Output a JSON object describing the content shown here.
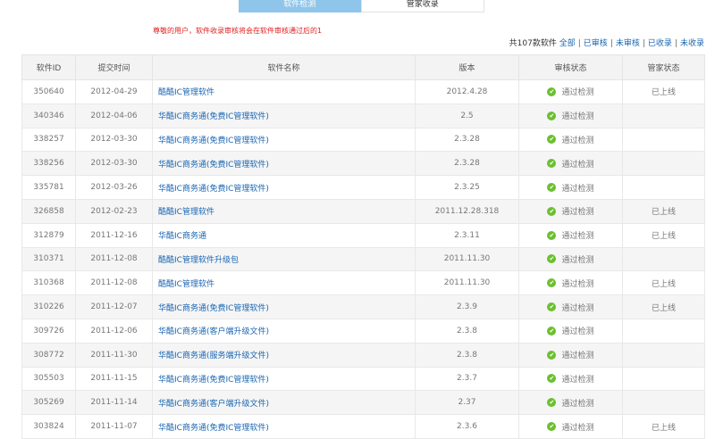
{
  "tabs": [
    {
      "label": "软件检测",
      "active": true
    },
    {
      "label": "管家收录",
      "active": false
    }
  ],
  "notice": "尊敬的用户，软件收录审核将会在软件审核通过后的1",
  "summary": {
    "count_text": "共107款软件",
    "filters": [
      "全部",
      "已审核",
      "未审核",
      "已收录",
      "未收录"
    ]
  },
  "table": {
    "headers": [
      "软件ID",
      "提交时间",
      "软件名称",
      "版本",
      "审核状态",
      "管家状态"
    ],
    "rows": [
      {
        "id": "350640",
        "date": "2012-04-29",
        "name": "酷酷IC管理软件",
        "version": "2012.4.28",
        "status": "通过检测",
        "manager": "已上线"
      },
      {
        "id": "340346",
        "date": "2012-04-06",
        "name": "华酷IC商务通(免费IC管理软件)",
        "version": "2.5",
        "status": "通过检测",
        "manager": ""
      },
      {
        "id": "338257",
        "date": "2012-03-30",
        "name": "华酷IC商务通(免费IC管理软件)",
        "version": "2.3.28",
        "status": "通过检测",
        "manager": ""
      },
      {
        "id": "338256",
        "date": "2012-03-30",
        "name": "华酷IC商务通(免费IC管理软件)",
        "version": "2.3.28",
        "status": "通过检测",
        "manager": ""
      },
      {
        "id": "335781",
        "date": "2012-03-26",
        "name": "华酷IC商务通(免费IC管理软件)",
        "version": "2.3.25",
        "status": "通过检测",
        "manager": ""
      },
      {
        "id": "326858",
        "date": "2012-02-23",
        "name": "酷酷IC管理软件",
        "version": "2011.12.28.318",
        "status": "通过检测",
        "manager": "已上线"
      },
      {
        "id": "312879",
        "date": "2011-12-16",
        "name": "华酷IC商务通",
        "version": "2.3.11",
        "status": "通过检测",
        "manager": "已上线"
      },
      {
        "id": "310371",
        "date": "2011-12-08",
        "name": "酷酷IC管理软件升级包",
        "version": "2011.11.30",
        "status": "通过检测",
        "manager": ""
      },
      {
        "id": "310368",
        "date": "2011-12-08",
        "name": "酷酷IC管理软件",
        "version": "2011.11.30",
        "status": "通过检测",
        "manager": "已上线"
      },
      {
        "id": "310226",
        "date": "2011-12-07",
        "name": "华酷IC商务通(免费IC管理软件)",
        "version": "2.3.9",
        "status": "通过检测",
        "manager": "已上线"
      },
      {
        "id": "309726",
        "date": "2011-12-06",
        "name": "华酷IC商务通(客户端升级文件)",
        "version": "2.3.8",
        "status": "通过检测",
        "manager": ""
      },
      {
        "id": "308772",
        "date": "2011-11-30",
        "name": "华酷IC商务通(服务端升级文件)",
        "version": "2.3.8",
        "status": "通过检测",
        "manager": ""
      },
      {
        "id": "305503",
        "date": "2011-11-15",
        "name": "华酷IC商务通(免费IC管理软件)",
        "version": "2.3.7",
        "status": "通过检测",
        "manager": ""
      },
      {
        "id": "305269",
        "date": "2011-11-14",
        "name": "华酷IC商务通(客户端升级文件)",
        "version": "2.37",
        "status": "通过检测",
        "manager": ""
      },
      {
        "id": "303824",
        "date": "2011-11-07",
        "name": "华酷IC商务通(免费IC管理软件)",
        "version": "2.3.6",
        "status": "通过检测",
        "manager": "已上线"
      }
    ]
  },
  "icons": {
    "status_ok": "check-circle-icon"
  },
  "colors": {
    "accent": "#8fc5ea",
    "link": "#1a66b3",
    "notice": "#e02020",
    "ok": "#6cbf2f"
  }
}
